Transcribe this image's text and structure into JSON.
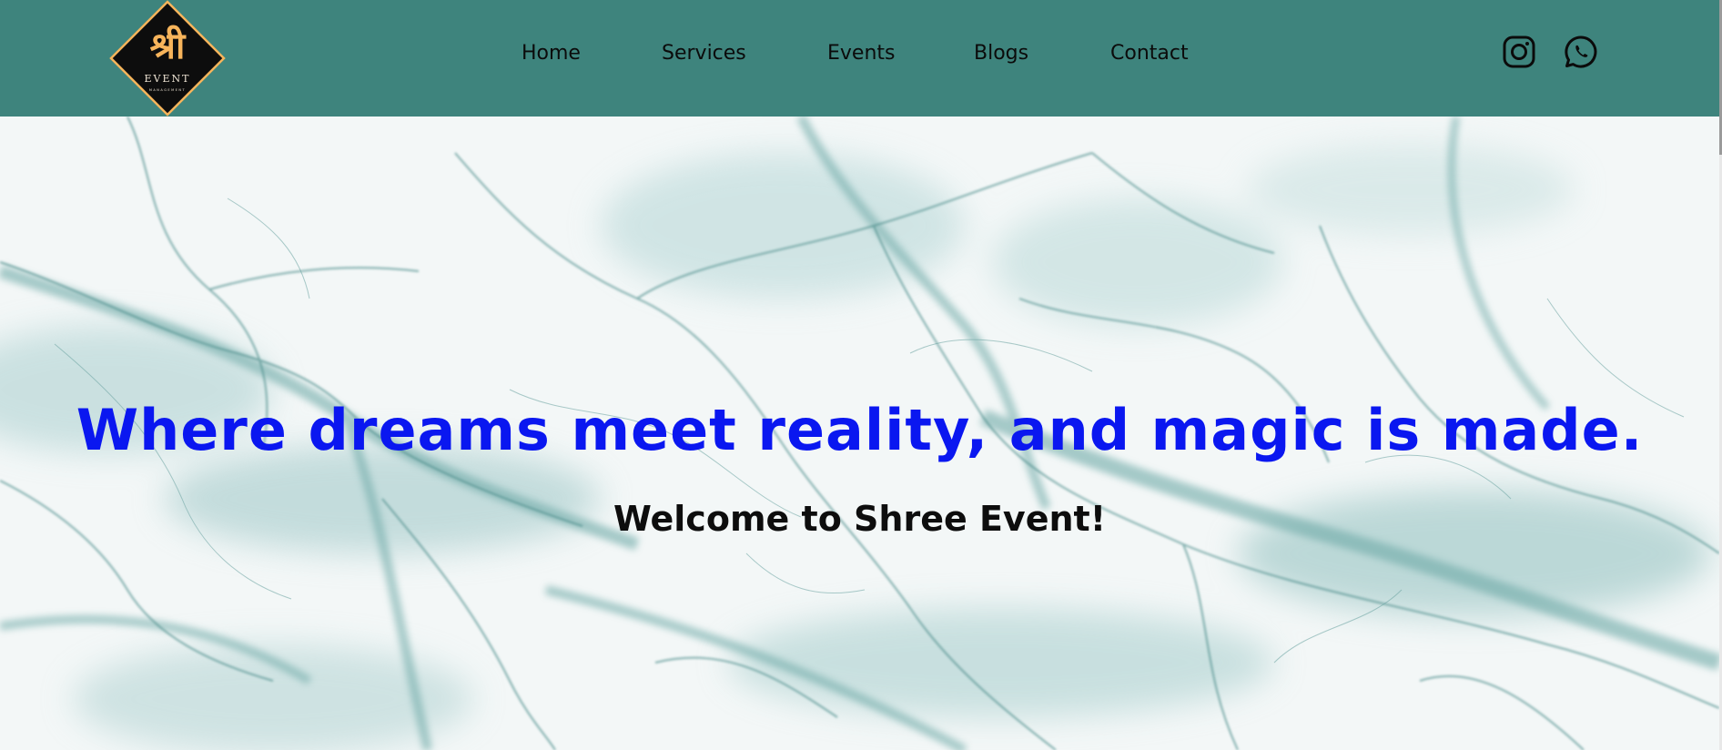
{
  "brand": {
    "logo_main": "श्री",
    "logo_sub": "EVENT",
    "logo_tag": "MANAGEMENT",
    "colors": {
      "header_bg": "#3e847d",
      "logo_gold": "#f7b45b",
      "logo_bg": "#0d0d0d",
      "headline": "#0a17f0"
    }
  },
  "nav": {
    "items": [
      {
        "label": "Home"
      },
      {
        "label": "Services"
      },
      {
        "label": "Events"
      },
      {
        "label": "Blogs"
      },
      {
        "label": "Contact"
      }
    ]
  },
  "social": {
    "icons": [
      "instagram-icon",
      "whatsapp-icon"
    ]
  },
  "hero": {
    "headline": "Where dreams meet reality, and magic is made.",
    "welcome": "Welcome to Shree Event!"
  }
}
